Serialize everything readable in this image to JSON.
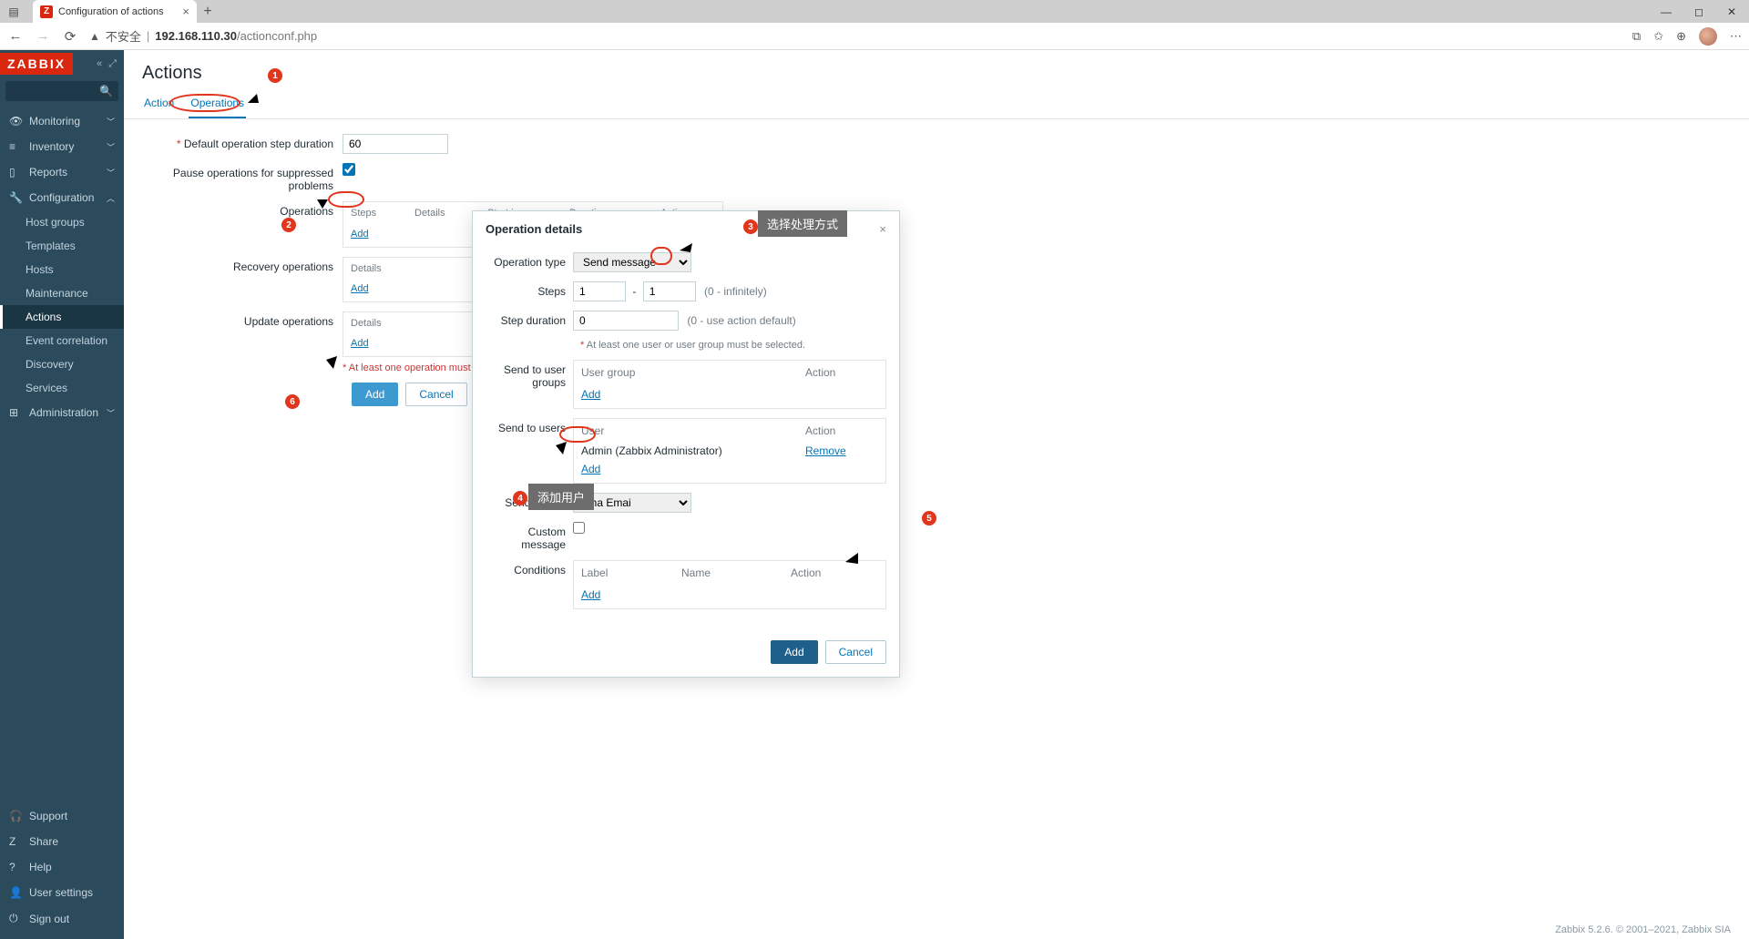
{
  "browser": {
    "tab_title": "Configuration of actions",
    "security_label": "不安全",
    "url_host": "192.168.110.30",
    "url_path": "/actionconf.php"
  },
  "sidebar": {
    "logo": "ZABBIX",
    "sections": [
      {
        "icon": "◉",
        "label": "Monitoring"
      },
      {
        "icon": "≡",
        "label": "Inventory"
      },
      {
        "icon": "▯",
        "label": "Reports"
      },
      {
        "icon": "🔧",
        "label": "Configuration",
        "expanded": true,
        "children": [
          "Host groups",
          "Templates",
          "Hosts",
          "Maintenance",
          "Actions",
          "Event correlation",
          "Discovery",
          "Services"
        ],
        "active_child": 4
      },
      {
        "icon": "⊞",
        "label": "Administration"
      }
    ],
    "bottom": [
      {
        "icon": "🎧",
        "label": "Support"
      },
      {
        "icon": "Z",
        "label": "Share"
      },
      {
        "icon": "?",
        "label": "Help"
      },
      {
        "icon": "👤",
        "label": "User settings"
      },
      {
        "icon": "⏻",
        "label": "Sign out"
      }
    ]
  },
  "page": {
    "title": "Actions",
    "tabs": [
      "Action",
      "Operations"
    ],
    "active_tab": 1,
    "form": {
      "default_duration_label": "Default operation step duration",
      "default_duration_value": "60",
      "pause_label": "Pause operations for suppressed problems",
      "pause_checked": true,
      "operations_label": "Operations",
      "ops_headers": [
        "Steps",
        "Details",
        "Start in",
        "Duration",
        "Action"
      ],
      "recovery_label": "Recovery operations",
      "update_label": "Update operations",
      "details_header": "Details",
      "add_link": "Add",
      "validation_note": "At least one operation must exist.",
      "submit": "Add",
      "cancel": "Cancel"
    }
  },
  "modal": {
    "title": "Operation details",
    "op_type_label": "Operation type",
    "op_type_value": "Send message",
    "steps_label": "Steps",
    "steps_from": "1",
    "steps_to": "1",
    "steps_hint": "(0 - infinitely)",
    "step_duration_label": "Step duration",
    "step_duration_value": "0",
    "step_duration_hint": "(0 - use action default)",
    "user_note": "At least one user or user group must be selected.",
    "send_groups_label": "Send to user groups",
    "groups_headers": [
      "User group",
      "Action"
    ],
    "send_users_label": "Send to users",
    "users_headers": [
      "User",
      "Action"
    ],
    "users_rows": [
      {
        "name": "Admin (Zabbix Administrator)",
        "action": "Remove"
      }
    ],
    "send_only_label": "Send only to",
    "send_only_value": "sina Emai",
    "custom_msg_label": "Custom message",
    "custom_msg_checked": false,
    "conditions_label": "Conditions",
    "conditions_headers": [
      "Label",
      "Name",
      "Action"
    ],
    "add_link": "Add",
    "submit": "Add",
    "cancel": "Cancel"
  },
  "annotations": {
    "tip1": "选择处理方式",
    "tip2": "添加用户"
  },
  "footer": "Zabbix 5.2.6. © 2001–2021, Zabbix SIA"
}
